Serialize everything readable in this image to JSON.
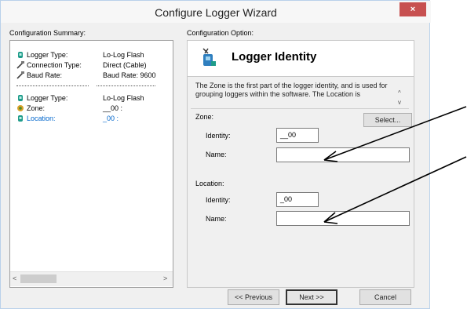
{
  "window": {
    "title": "Configure Logger Wizard",
    "close_label": "×"
  },
  "summary": {
    "heading": "Configuration Summary:",
    "rows": [
      {
        "key": "Logger Type:",
        "value": "Lo-Log Flash",
        "icon": "logger-icon"
      },
      {
        "key": "Connection Type:",
        "value": "Direct (Cable)",
        "icon": "cable-icon"
      },
      {
        "key": "Baud Rate:",
        "value": "Baud Rate: 9600",
        "icon": "cable-icon"
      },
      {
        "key": "Logger Type:",
        "value": "Lo-Log Flash",
        "icon": "logger-icon"
      },
      {
        "key": "Zone:",
        "value": "__00 :",
        "icon": "zone-icon"
      },
      {
        "key": "Location:",
        "value": "_00 :",
        "icon": "logger-icon",
        "highlight_color": "#0066cc"
      }
    ],
    "scroll_left": "<",
    "scroll_right": ">"
  },
  "option": {
    "heading": "Configuration Option:",
    "header_title": "Logger Identity",
    "description": "The Zone is the first part of the logger identity, and is used for grouping loggers within the software. The Location is",
    "zone": {
      "label": "Zone:",
      "select_label": "Select...",
      "identity_label": "Identity:",
      "identity_value": "__00",
      "name_label": "Name:",
      "name_value": ""
    },
    "location": {
      "label": "Location:",
      "identity_label": "Identity:",
      "identity_value": "_00",
      "name_label": "Name:",
      "name_value": ""
    }
  },
  "buttons": {
    "previous": "<< Previous",
    "next": "Next >>",
    "cancel": "Cancel"
  }
}
